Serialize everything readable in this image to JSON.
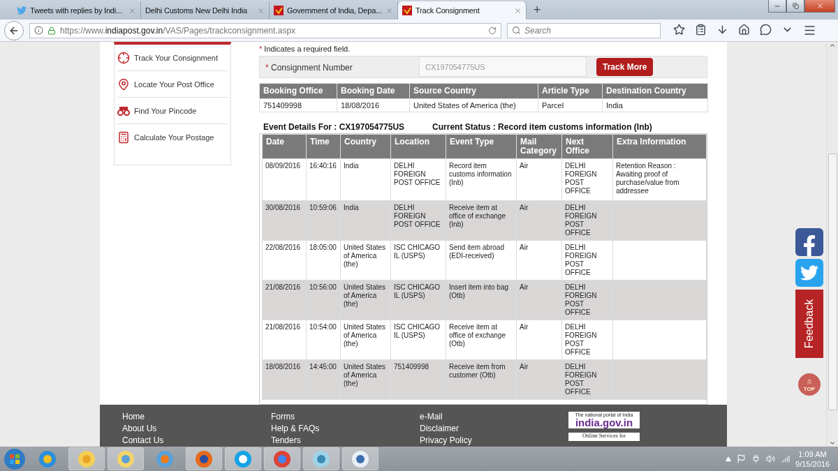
{
  "browser": {
    "tabs": [
      {
        "label": "Tweets with replies by Indi...",
        "kind": "bird",
        "selected": false
      },
      {
        "label": "Delhi Customs New Delhi India",
        "kind": "none",
        "selected": false
      },
      {
        "label": "Government of India, Depa...",
        "kind": "post",
        "selected": false
      },
      {
        "label": "Track Consignment",
        "kind": "post",
        "selected": true
      }
    ],
    "new_tab": "+",
    "url_prefix": "https://www.",
    "url_domain": "indiapost.gov.in",
    "url_path": "/VAS/Pages/trackconsignment.aspx",
    "search": {
      "placeholder": "Search"
    }
  },
  "sidebar": {
    "items": [
      {
        "label": "Track Your Consignment",
        "kind": "target"
      },
      {
        "label": "Locate Your Post Office",
        "kind": "pin"
      },
      {
        "label": "Find Your Pincode",
        "kind": "binoculars"
      },
      {
        "label": "Calculate Your Postage",
        "kind": "calculator"
      }
    ]
  },
  "form": {
    "required_mark": "*",
    "required_note": "Indicates a required field.",
    "label": "Consignment Number",
    "value": "CX197054775US",
    "button": "Track More"
  },
  "booking": {
    "columns": [
      "Booking Office",
      "Booking Date",
      "Source Country",
      "Article Type",
      "Destination Country"
    ],
    "row": [
      "751409998",
      "18/08/2016",
      "United States of America (the)",
      "Parcel",
      "India"
    ]
  },
  "event_title": "Event Details For : CX197054775US",
  "status_title": "Current Status : Record item customs information (Inb)",
  "events": {
    "columns": [
      "Date",
      "Time",
      "Country",
      "Location",
      "Event Type",
      "Mail Category",
      "Next Office",
      "Extra Information"
    ],
    "rows": [
      [
        "08/09/2016",
        "16:40:16",
        "India",
        "DELHI FOREIGN POST OFFICE",
        "Record item customs information (Inb)",
        "Air",
        "DELHI FOREIGN POST OFFICE",
        "Retention Reason : Awaiting proof of purchase/value from addressee"
      ],
      [
        "30/08/2016",
        "10:59:06",
        "India",
        "DELHI FOREIGN POST OFFICE",
        "Receive item at office of exchange (Inb)",
        "Air",
        "DELHI FOREIGN POST OFFICE",
        ""
      ],
      [
        "22/08/2016",
        "18:05:00",
        "United States of America (the)",
        "ISC CHICAGO IL (USPS)",
        "Send item abroad (EDI-received)",
        "Air",
        "DELHI FOREIGN POST OFFICE",
        ""
      ],
      [
        "21/08/2016",
        "10:56:00",
        "United States of America (the)",
        "ISC CHICAGO IL (USPS)",
        "Insert item into bag (Otb)",
        "Air",
        "DELHI FOREIGN POST OFFICE",
        ""
      ],
      [
        "21/08/2016",
        "10:54:00",
        "United States of America (the)",
        "ISC CHICAGO IL (USPS)",
        "Receive item at office of exchange (Otb)",
        "Air",
        "DELHI FOREIGN POST OFFICE",
        ""
      ],
      [
        "18/08/2016",
        "14:45:00",
        "United States of America (the)",
        "751409998",
        "Receive item from customer (Otb)",
        "Air",
        "DELHI FOREIGN POST OFFICE",
        ""
      ]
    ]
  },
  "side_buttons": {
    "feedback": "Feedback",
    "top": "TOP"
  },
  "footer": {
    "columns": [
      [
        "Home",
        "About Us",
        "Contact Us"
      ],
      [
        "Forms",
        "Help & FAQs",
        "Tenders"
      ],
      [
        "e-Mail",
        "Disclaimer",
        "Privacy Policy"
      ]
    ],
    "portal_caption": "The national portal of India",
    "portal_name": "india.gov.in",
    "services": "Online Services for"
  },
  "taskbar": {
    "apps": [
      {
        "kind": "ie"
      },
      {
        "kind": "outlook"
      },
      {
        "kind": "explorer"
      },
      {
        "kind": "media"
      },
      {
        "kind": "firefox"
      },
      {
        "kind": "skype"
      },
      {
        "kind": "chrome"
      },
      {
        "kind": "notepad"
      },
      {
        "kind": "wordpad"
      }
    ],
    "time": "1:09 AM",
    "date": "9/15/2016"
  }
}
